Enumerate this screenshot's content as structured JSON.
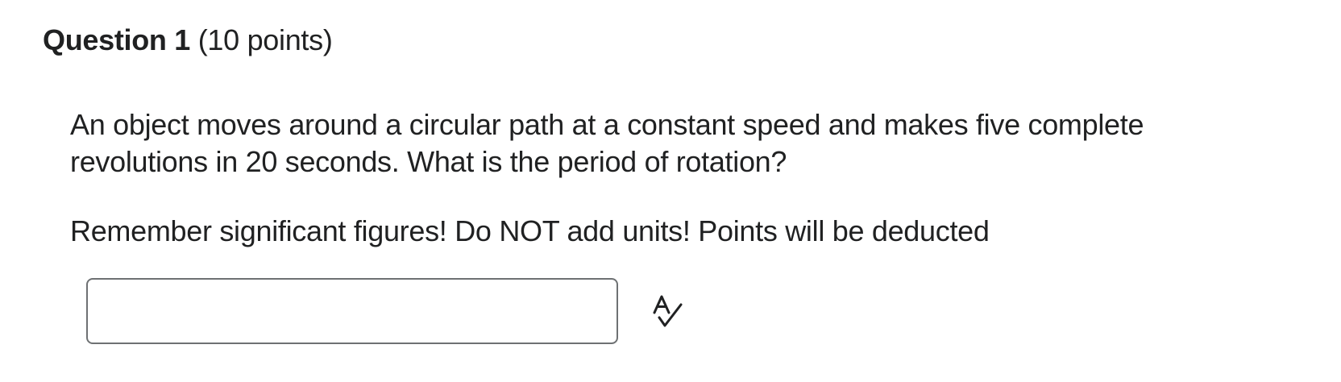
{
  "question": {
    "title": "Question 1",
    "points": "(10 points)",
    "prompt": "An object moves around a circular path at a constant speed and makes five complete revolutions in 20 seconds. What is the period of rotation?",
    "note": "Remember significant figures! Do NOT add units! Points will be deducted"
  },
  "answer": {
    "value": "",
    "placeholder": ""
  },
  "icons": {
    "spellcheck": "spellcheck-icon"
  },
  "colors": {
    "text": "#202122",
    "input_border": "#6e7173"
  }
}
